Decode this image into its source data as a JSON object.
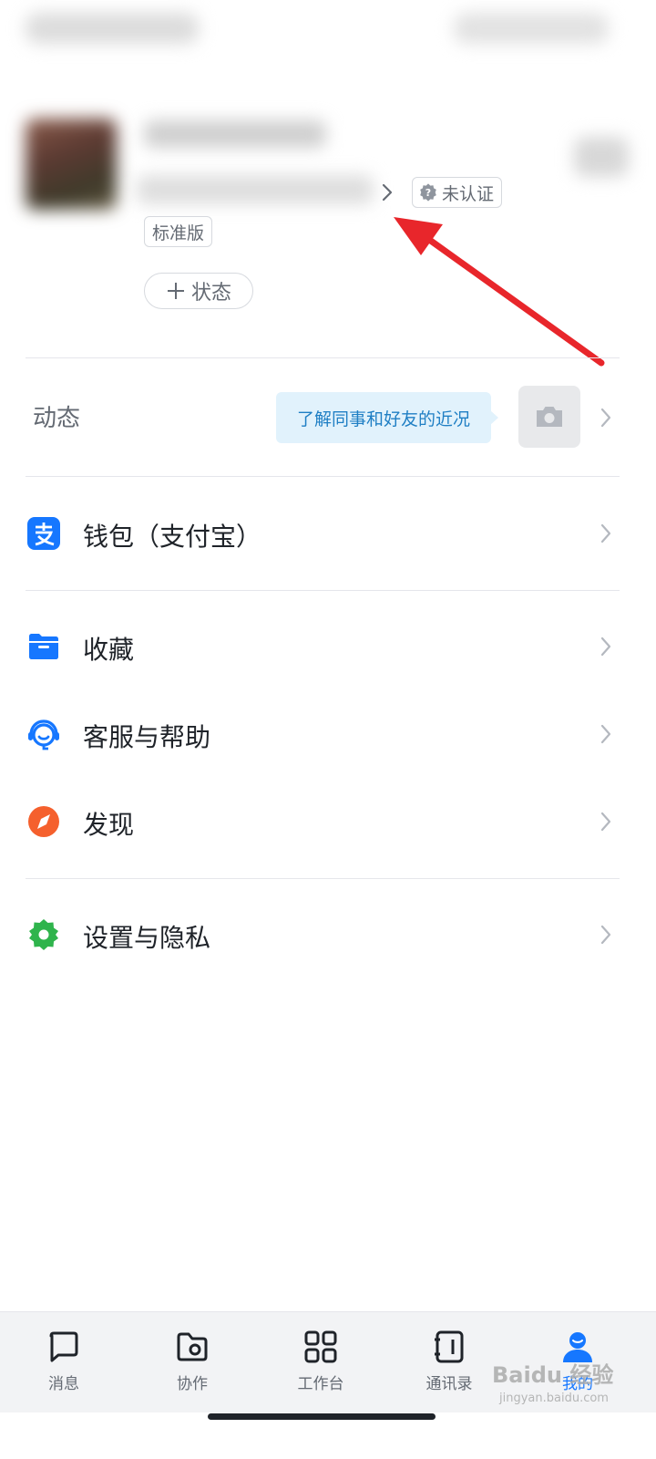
{
  "profile": {
    "org_chevron_icon": "chevron-right-icon",
    "cert_icon": "question-shield-icon",
    "cert_status": "未认证",
    "edition": "标准版",
    "status_button": "状态"
  },
  "moments": {
    "label": "动态",
    "tip": "了解同事和好友的近况",
    "camera_icon": "camera-icon"
  },
  "menu": {
    "wallet": {
      "label": "钱包（支付宝）",
      "icon": "alipay-icon",
      "color": "#1677ff"
    },
    "favorites": {
      "label": "收藏",
      "icon": "folder-icon",
      "color": "#1677ff"
    },
    "support": {
      "label": "客服与帮助",
      "icon": "headset-icon",
      "color": "#1677ff"
    },
    "discover": {
      "label": "发现",
      "icon": "compass-icon",
      "color": "#f5602d"
    },
    "settings": {
      "label": "设置与隐私",
      "icon": "gear-icon",
      "color": "#2fb44c"
    }
  },
  "tabbar": {
    "messages": "消息",
    "collab": "协作",
    "workbench": "工作台",
    "contacts": "通讯录",
    "me": "我的",
    "active_color": "#1677ff"
  },
  "watermark": {
    "text": "Baidu 经验",
    "sub": "jingyan.baidu.com"
  },
  "colors": {
    "annotation_arrow": "#e8262b",
    "tip_bg": "#e1f2fc",
    "tip_text": "#1f7fc4"
  }
}
